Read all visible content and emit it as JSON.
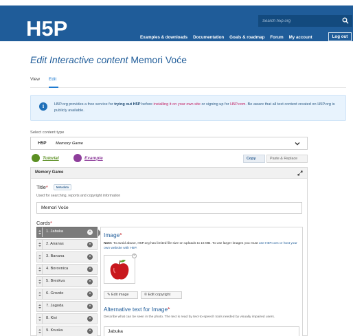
{
  "header": {
    "logo_text": "H5P",
    "search_placeholder": "Search h5p.org",
    "nav": [
      "Examples & downloads",
      "Documentation",
      "Goals & roadmap",
      "Forum",
      "My account"
    ],
    "logout_label": "Log out",
    "brand_color": "#1f5c99"
  },
  "page": {
    "title_prefix": "Edit Interactive content",
    "title_name": "Memori Voće",
    "tabs": [
      "View",
      "Edit"
    ],
    "active_tab": "Edit"
  },
  "notice": {
    "icon": "info-icon",
    "t1": "H5P.org provides a free service for ",
    "b1": "trying out H5P",
    "t2": " before ",
    "l1": "installing it on your own site",
    "t3": " or signing up for ",
    "l2": "H5P.com",
    "t4": ". Be aware that all test content created on H5P.org is publicly available."
  },
  "content_type": {
    "label": "Select content type",
    "logo": "H5P",
    "value": "Memory Game",
    "tutorial": "Tutorial",
    "example": "Example",
    "copy": "Copy",
    "paste": "Paste & Replace"
  },
  "editor": {
    "header": "Memory Game",
    "title_label": "Title",
    "metadata_label": "Metadata",
    "title_desc": "Used for searching, reports and copyright information",
    "title_value": "Memori Voće",
    "cards_label": "Cards",
    "cards": [
      "1. Jabuka",
      "2. Ananas",
      "3. Banana",
      "4. Borovnica",
      "5. Breskva",
      "6. Grozde",
      "7. Jagoda",
      "8. Kivi",
      "9. Kruska"
    ],
    "active_card": 0,
    "image_label": "Image",
    "image_note_b": "Note:",
    "image_note_t": " To avoid abuse, H5P.org has limited file size on uploads to 16 MB. To use larger images you must ",
    "image_note_l": "use H5P.com or host your own website with H5P.",
    "edit_image": "Edit image",
    "edit_copyright": "Edit copyright",
    "alt_label": "Alternative text for Image",
    "alt_desc": "Describe what can be seen in the photo. The text is read by text-to-speech tools needed by visually impaired users.",
    "alt_value": "Jabuka"
  }
}
